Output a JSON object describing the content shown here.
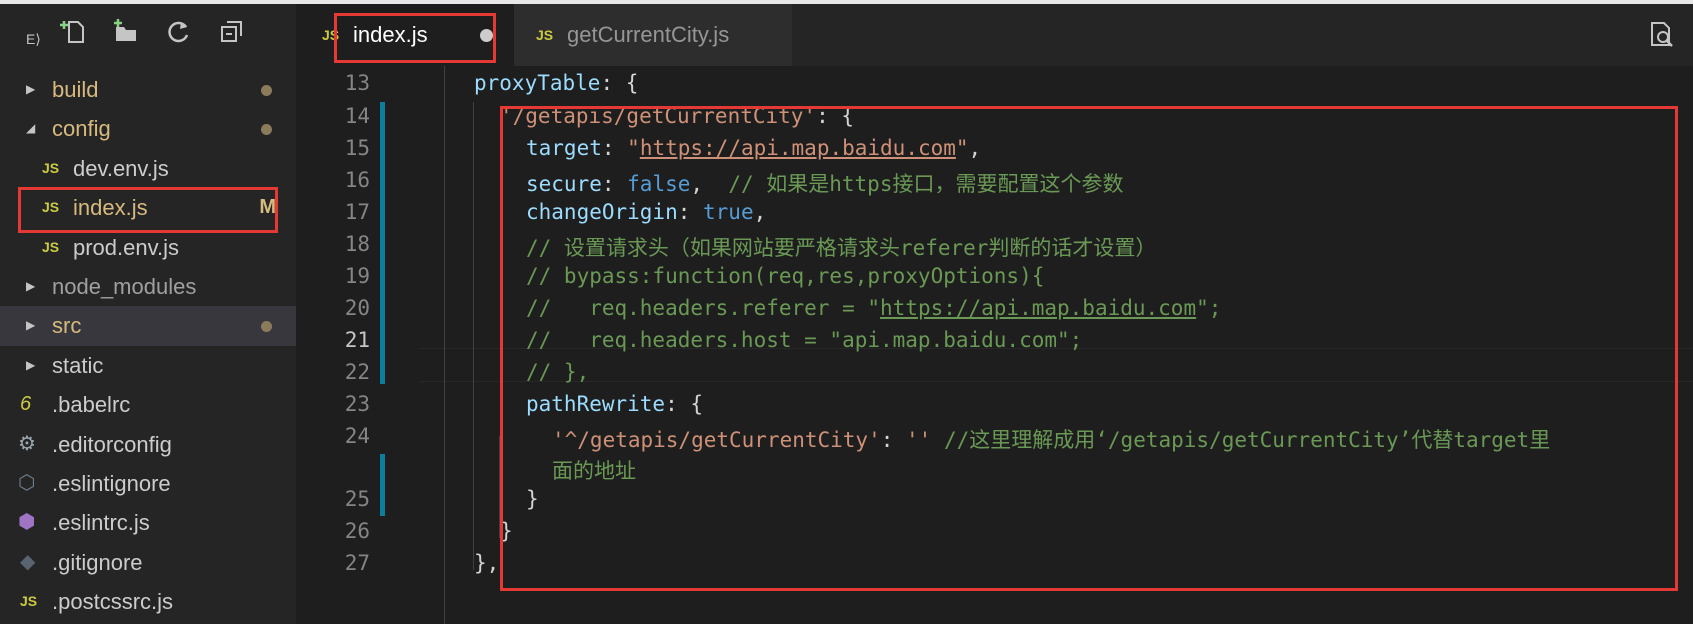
{
  "sidebar": {
    "toolbar": {
      "explorer_label": "E⟩",
      "icons": [
        "new-file-icon",
        "new-folder-icon",
        "refresh-icon",
        "collapse-all-icon"
      ]
    },
    "items": [
      {
        "label": "build",
        "type": "folder",
        "expanded": false,
        "status": "dot"
      },
      {
        "label": "config",
        "type": "folder",
        "expanded": true,
        "status": "dot"
      },
      {
        "label": "dev.env.js",
        "type": "js"
      },
      {
        "label": "index.js",
        "type": "js",
        "status_text": "M"
      },
      {
        "label": "prod.env.js",
        "type": "js"
      },
      {
        "label": "node_modules",
        "type": "folder",
        "expanded": false
      },
      {
        "label": "src",
        "type": "folder",
        "expanded": false,
        "status": "dot",
        "selected": true
      },
      {
        "label": "static",
        "type": "folder",
        "expanded": false
      },
      {
        "label": ".babelrc",
        "type": "babel"
      },
      {
        "label": ".editorconfig",
        "type": "gear"
      },
      {
        "label": ".eslintignore",
        "type": "eslint"
      },
      {
        "label": ".eslintrc.js",
        "type": "eslint-purple"
      },
      {
        "label": ".gitignore",
        "type": "git"
      },
      {
        "label": ".postcssrc.js",
        "type": "js"
      }
    ]
  },
  "tabs": [
    {
      "badge": "JS",
      "label": "index.js",
      "active": true,
      "dirty": true
    },
    {
      "badge": "JS",
      "label": "getCurrentCity.js",
      "active": false
    }
  ],
  "editor": {
    "active_line": 21,
    "line_numbers": [
      "13",
      "14",
      "15",
      "16",
      "17",
      "18",
      "19",
      "20",
      "21",
      "22",
      "23",
      "24",
      "25",
      "26",
      "27"
    ],
    "lines": {
      "l13": {
        "key": "proxyTable",
        "rest": ": {"
      },
      "l14": {
        "str": "'/getapis/getCurrentCity'",
        "rest": ": {"
      },
      "l15": {
        "key": "target",
        "p1": ": ",
        "q1": "\"",
        "url": "https://api.map.baidu.com",
        "q2": "\"",
        "p2": ","
      },
      "l16": {
        "key": "secure",
        "p1": ": ",
        "bool": "false",
        "p2": ",  ",
        "comment": "// 如果是https接口，需要配置这个参数"
      },
      "l17": {
        "key": "changeOrigin",
        "p1": ": ",
        "bool": "true",
        "p2": ","
      },
      "l18": {
        "comment": "// 设置请求头（如果网站要严格请求头referer判断的话才设置）"
      },
      "l19": {
        "comment": "// bypass:function(req,res,proxyOptions){"
      },
      "l20": {
        "c1": "//   req.headers.referer = \"",
        "url": "https://api.map.baidu.com",
        "c2": "\";"
      },
      "l21": {
        "comment": "//   req.headers.host = \"api.map.baidu.com\";"
      },
      "l22": {
        "comment": "// },"
      },
      "l23": {
        "key": "pathRewrite",
        "rest": ": {"
      },
      "l24": {
        "str1": "'^/getapis/getCurrentCity'",
        "p1": ": ",
        "str2": "''",
        "p2": " ",
        "comment": "//这里理解成用‘/getapis/getCurrentCity’代替target里",
        "comment_wrap": "面的地址"
      },
      "l25": {
        "text": "}"
      },
      "l26": {
        "text": "}"
      },
      "l27": {
        "text": "},"
      }
    }
  },
  "colors": {
    "highlight_box": "#e53935",
    "key": "#9cdcfe",
    "string": "#ce9178",
    "comment": "#6a9955",
    "keyword": "#569cd6",
    "git_modified": "#d7ba7d",
    "git_gutter": "#0c7d9d"
  }
}
